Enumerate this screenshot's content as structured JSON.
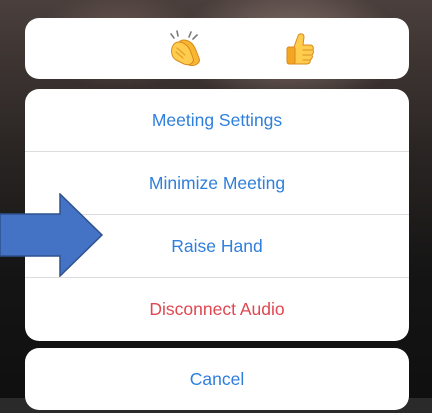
{
  "reactions": [
    {
      "name": "clapping-hands",
      "icon": "clap-emoji"
    },
    {
      "name": "thumbs-up",
      "icon": "thumbs-up-emoji"
    }
  ],
  "menu": {
    "items": [
      {
        "label": "Meeting Settings"
      },
      {
        "label": "Minimize Meeting"
      },
      {
        "label": "Raise Hand"
      },
      {
        "label": "Disconnect Audio"
      }
    ],
    "cancel_label": "Cancel"
  },
  "colors": {
    "accent": "#2f7fdc",
    "danger": "#e0474f",
    "annotation_arrow": "#4472c4"
  }
}
